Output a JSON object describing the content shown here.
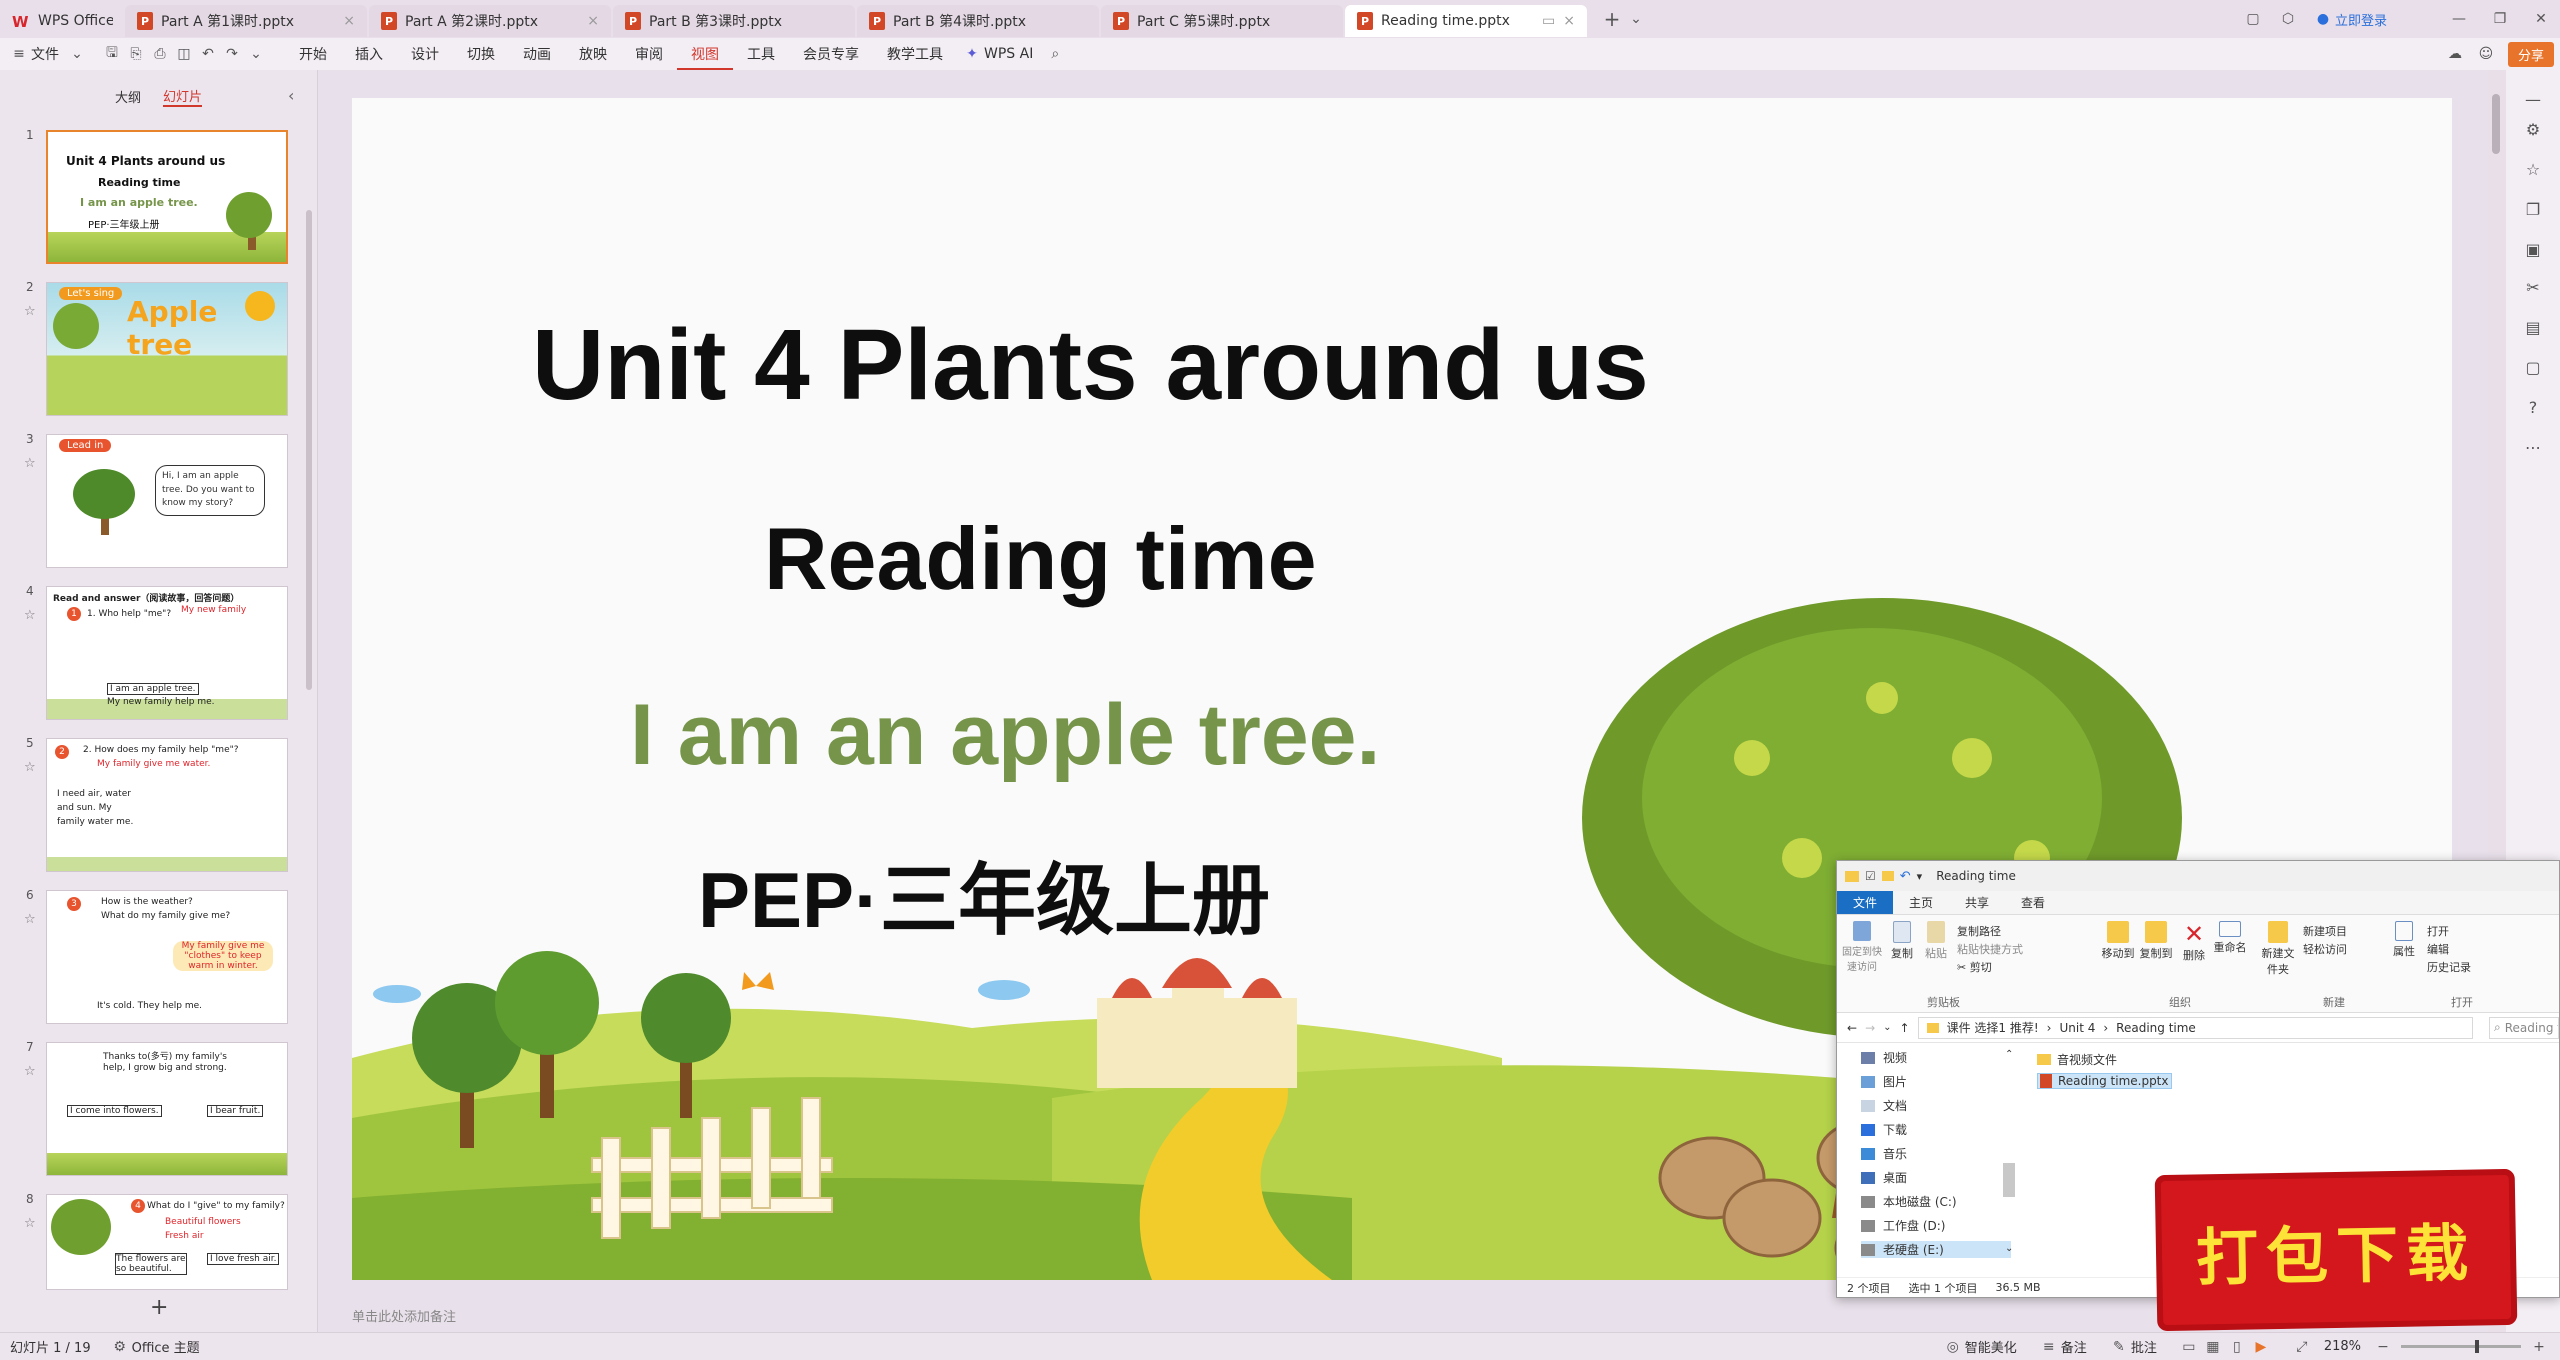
{
  "tabs": [
    {
      "label": "WPS Office",
      "kind": "home"
    },
    {
      "label": "Part  A 第1课时.pptx",
      "kind": "doc"
    },
    {
      "label": "Part  A 第2课时.pptx",
      "kind": "doc"
    },
    {
      "label": "Part  B 第3课时.pptx",
      "kind": "doc"
    },
    {
      "label": "Part  B 第4课时.pptx",
      "kind": "doc"
    },
    {
      "label": "Part  C 第5课时.pptx",
      "kind": "doc"
    },
    {
      "label": "Reading time.pptx",
      "kind": "doc",
      "active": true
    }
  ],
  "topright": {
    "login": "立即登录",
    "share": "分享"
  },
  "menu": {
    "file": "文件",
    "items": [
      "开始",
      "插入",
      "设计",
      "切换",
      "动画",
      "放映",
      "审阅",
      "视图",
      "工具",
      "会员专享",
      "教学工具"
    ],
    "active": "视图",
    "ai": "WPS AI"
  },
  "panel": {
    "outline_tab": "大纲",
    "slides_tab": "幻灯片"
  },
  "thumbnails": {
    "s1": {
      "num": "1",
      "title": "Unit 4 Plants around us",
      "sub": "Reading time",
      "line3": "I am an apple tree.",
      "line4": "PEP·三年级上册"
    },
    "s2": {
      "num": "2",
      "tag": "Let's sing",
      "title": "Apple tree"
    },
    "s3": {
      "num": "3",
      "tag": "Lead in",
      "bubble": "Hi, I am an apple tree. Do you want to know my story?"
    },
    "s4": {
      "num": "4",
      "head": "Read and answer（阅读故事，回答问题）",
      "q": "1. Who help \"me\"?",
      "a": "My new family",
      "c1": "I am an apple tree.",
      "c2": "My new family help me."
    },
    "s5": {
      "num": "5",
      "q": "2. How does my family help \"me\"?",
      "a": "My family give me water.",
      "c1": "I need air, water",
      "c2": "and sun. My",
      "c3": "family water me."
    },
    "s6": {
      "num": "6",
      "q": "How is the weather?",
      "q2": "What do my family give me?",
      "a": "My family give me \"clothes\" to keep warm in winter.",
      "c1": "It's cold. They help me."
    },
    "s7": {
      "num": "7",
      "q": "Thanks to(多亏) my family's",
      "q2": "help, I grow big and strong.",
      "c1": "I come into flowers.",
      "c2": "I bear fruit."
    },
    "s8": {
      "num": "8",
      "q": "What do I \"give\" to my family?",
      "a1": "Beautiful flowers",
      "a2": "Fresh air",
      "c1": "The flowers are so beautiful.",
      "c2": "I love fresh air."
    }
  },
  "slide": {
    "title": "Unit 4 Plants around us",
    "subtitle": "Reading time",
    "line3": "I am an apple tree.",
    "line4": "PEP·三年级上册"
  },
  "notes_placeholder": "单击此处添加备注",
  "status": {
    "slide_pos": "幻灯片 1 / 19",
    "theme": "Office 主题",
    "beautify": "智能美化",
    "notes": "备注",
    "comments": "批注",
    "zoom": "218%"
  },
  "explorer": {
    "title": "Reading time",
    "ribbon_tabs": [
      "文件",
      "主页",
      "共享",
      "查看"
    ],
    "ribbon": {
      "pin": "固定到快速访问",
      "copy": "复制",
      "paste": "粘贴",
      "copy_path": "复制路径",
      "paste_shortcut": "粘贴快捷方式",
      "cut": "剪切",
      "move_to": "移动到",
      "copy_to": "复制到",
      "delete": "删除",
      "rename": "重命名",
      "new_folder": "新建文件夹",
      "new_item": "新建项目",
      "easy_access": "轻松访问",
      "properties": "属性",
      "open": "打开",
      "edit": "编辑",
      "history": "历史记录",
      "g_clipboard": "剪贴板",
      "g_organize": "组织",
      "g_new": "新建",
      "g_open": "打开"
    },
    "path": [
      "课件 选择1 推荐!",
      "Unit 4",
      "Reading time"
    ],
    "search_placeholder": "Reading time",
    "nav": [
      "视频",
      "图片",
      "文档",
      "下载",
      "音乐",
      "桌面",
      "本地磁盘 (C:)",
      "工作盘 (D:)",
      "老硬盘 (E:)"
    ],
    "files": [
      "音视频文件",
      "Reading time.pptx"
    ],
    "status": {
      "count": "2 个项目",
      "selected": "选中 1 个项目",
      "size": "36.5 MB"
    }
  },
  "stamp": "打包下载",
  "colors": {
    "accent": "#d2372c",
    "green_text": "#76954a",
    "stamp_bg": "#d4171d",
    "stamp_text": "#fde338"
  }
}
